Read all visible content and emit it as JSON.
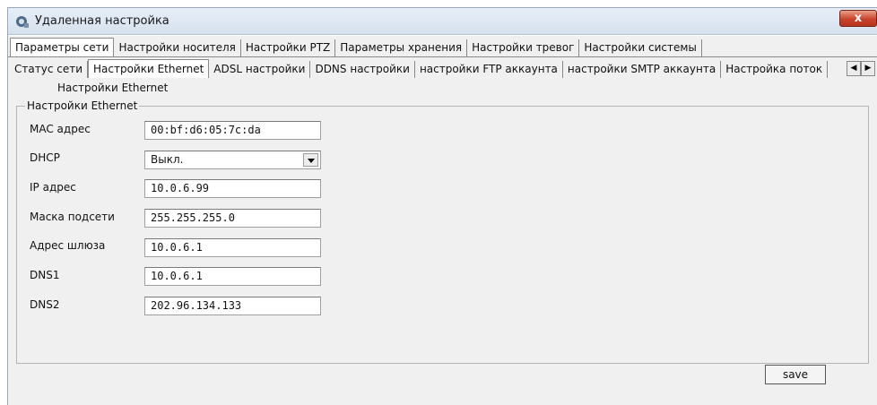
{
  "window": {
    "title": "Удаленная настройка",
    "close_label": "x"
  },
  "tabs_main": [
    {
      "label": "Параметры сети",
      "active": true
    },
    {
      "label": "Настройки носителя",
      "active": false
    },
    {
      "label": "Настройки PTZ",
      "active": false
    },
    {
      "label": "Параметры хранения",
      "active": false
    },
    {
      "label": "Настройки тревог",
      "active": false
    },
    {
      "label": "Настройки системы",
      "active": false
    }
  ],
  "tabs_sub": [
    {
      "label": "Статус сети",
      "active": false
    },
    {
      "label": "Настройки Ethernet",
      "active": true
    },
    {
      "label": "ADSL настройки",
      "active": false
    },
    {
      "label": "DDNS настройки",
      "active": false
    },
    {
      "label": "настройки FTP аккаунта",
      "active": false
    },
    {
      "label": "настройки SMTP аккаунта",
      "active": false
    },
    {
      "label": "Настройка поток",
      "active": false
    }
  ],
  "scroll": {
    "left": "◀",
    "right": "▶"
  },
  "section": {
    "heading": "Настройки Ethernet",
    "group_label": "Настройки Ethernet"
  },
  "fields": {
    "mac": {
      "label": "MAC адрес",
      "value": "00:bf:d6:05:7c:da"
    },
    "dhcp": {
      "label": "DHCP",
      "value": "Выкл."
    },
    "ip": {
      "label": "IP адрес",
      "value": "10.0.6.99"
    },
    "mask": {
      "label": "Маска подсети",
      "value": "255.255.255.0"
    },
    "gateway": {
      "label": "Адрес шлюза",
      "value": "10.0.6.1"
    },
    "dns1": {
      "label": "DNS1",
      "value": "10.0.6.1"
    },
    "dns2": {
      "label": "DNS2",
      "value": "202.96.134.133"
    }
  },
  "actions": {
    "save_label": "save"
  },
  "colors": {
    "titlebar": "#d6e1ee",
    "close": "#c9432a",
    "panel": "#f0f0f0"
  }
}
